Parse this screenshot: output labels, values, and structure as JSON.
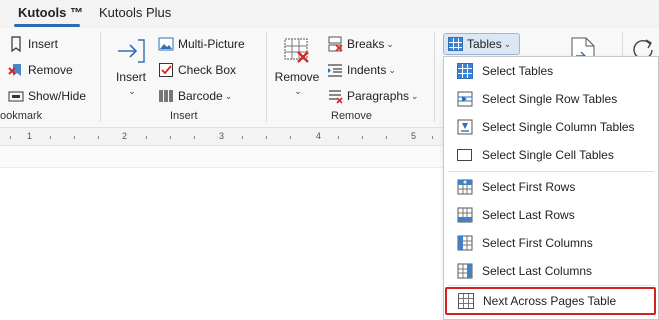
{
  "tabs": [
    {
      "label": "Kutools ™",
      "active": true
    },
    {
      "label": "Kutools Plus",
      "active": false
    }
  ],
  "ribbon": {
    "bookmark_group": {
      "label": "ookmark",
      "buttons": {
        "insert": "Insert",
        "remove": "Remove",
        "show_hide": "Show/Hide"
      }
    },
    "insert_group": {
      "label": "Insert",
      "big_insert": "Insert",
      "buttons": {
        "multi_picture": "Multi-Picture",
        "check_box": "Check Box",
        "barcode": "Barcode"
      }
    },
    "remove_group": {
      "label": "Remove",
      "big_remove": "Remove",
      "buttons": {
        "breaks": "Breaks",
        "indents": "Indents",
        "paragraphs": "Paragraphs"
      }
    },
    "tables_button": "Tables"
  },
  "ruler": {
    "numbers": [
      "1",
      "2",
      "3",
      "4",
      "5"
    ]
  },
  "tables_menu": {
    "items": [
      {
        "label": "Select Tables",
        "icon": "table-select-icon"
      },
      {
        "label": "Select Single Row Tables",
        "icon": "single-row-table-icon"
      },
      {
        "label": "Select Single Column Tables",
        "icon": "single-column-table-icon"
      },
      {
        "label": "Select Single Cell Tables",
        "icon": "single-cell-table-icon"
      },
      {
        "label": "Select First Rows",
        "icon": "first-row-icon"
      },
      {
        "label": "Select Last Rows",
        "icon": "last-row-icon"
      },
      {
        "label": "Select First Columns",
        "icon": "first-column-icon"
      },
      {
        "label": "Select Last Columns",
        "icon": "last-column-icon"
      },
      {
        "label": "Next Across Pages Table",
        "icon": "across-pages-table-icon"
      }
    ],
    "highlight_color": "#d32020"
  },
  "colors": {
    "accent": "#2b6cb5",
    "pressed_bg": "#dbe7f4"
  }
}
